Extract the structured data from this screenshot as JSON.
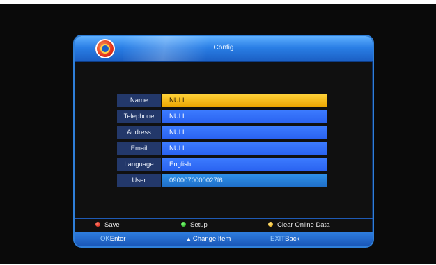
{
  "window": {
    "title": "Config"
  },
  "fields": [
    {
      "label": "Name",
      "value": "NULL",
      "state": "selected"
    },
    {
      "label": "Telephone",
      "value": "NULL",
      "state": "normal"
    },
    {
      "label": "Address",
      "value": "NULL",
      "state": "normal"
    },
    {
      "label": "Email",
      "value": "NULL",
      "state": "normal"
    },
    {
      "label": "Language",
      "value": "English",
      "state": "normal"
    },
    {
      "label": "User",
      "value": "0900070000027f6",
      "state": "disabled"
    }
  ],
  "color_buttons": {
    "red": {
      "label": "Save",
      "icon": "red-dot-icon"
    },
    "green": {
      "label": "Setup",
      "icon": "green-dot-icon"
    },
    "yellow": {
      "label": "Clear Online Data",
      "icon": "yellow-dot-icon"
    }
  },
  "keys": {
    "ok": {
      "key": "OK",
      "action": "Enter"
    },
    "updown": {
      "key": "",
      "action": "Change Item",
      "icon": "up-down-arrow-icon"
    },
    "exit": {
      "key": "EXIT",
      "action": "Back"
    }
  },
  "colors": {
    "accent_blue": "#2a62f0",
    "selected_yellow": "#eba500",
    "title_bar_blue": "#2a7fe6"
  }
}
